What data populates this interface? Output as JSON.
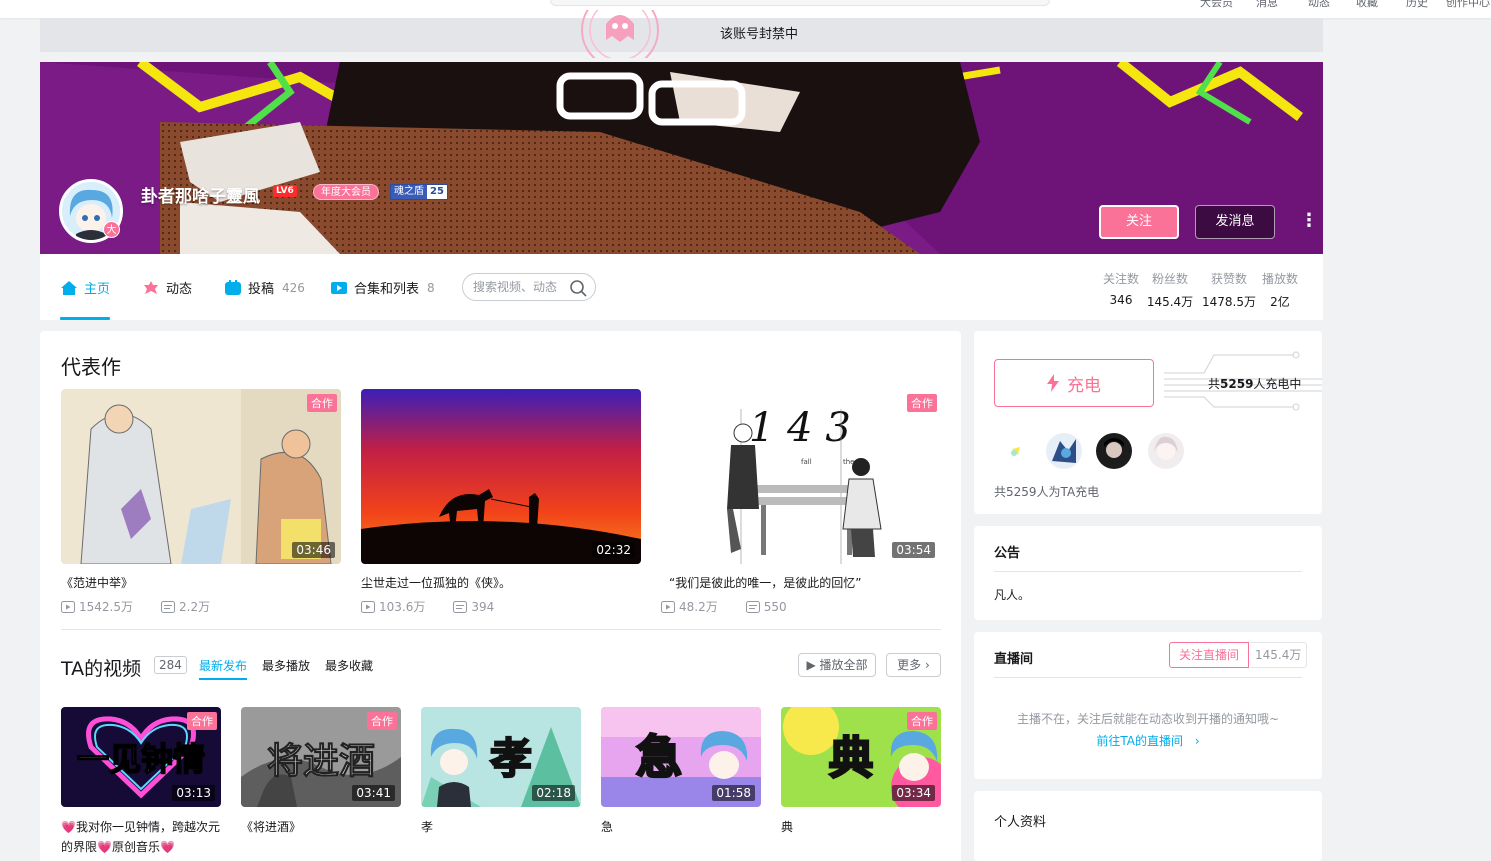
{
  "header": {
    "nav_fragments": [
      "大会员",
      "消息",
      "动态",
      "收藏",
      "历史",
      "创作中心"
    ]
  },
  "banned_notice": "该账号封禁中",
  "profile": {
    "username": "卦者那啥子靈風",
    "level": "LV6",
    "vip_label": "年度大会员",
    "medal_name": "魂之盾",
    "medal_level": "25",
    "avatar_badge": "大",
    "follow_label": "关注",
    "message_label": "发消息"
  },
  "tabs": [
    {
      "label": "主页",
      "count": ""
    },
    {
      "label": "动态",
      "count": ""
    },
    {
      "label": "投稿",
      "count": "426"
    },
    {
      "label": "合集和列表",
      "count": "8"
    }
  ],
  "search": {
    "placeholder": "搜索视频、动态"
  },
  "stats": [
    {
      "label": "关注数",
      "value": "346"
    },
    {
      "label": "粉丝数",
      "value": "145.4万"
    },
    {
      "label": "获赞数",
      "value": "1478.5万"
    },
    {
      "label": "播放数",
      "value": "2亿"
    }
  ],
  "representative": {
    "title": "代表作",
    "videos": [
      {
        "title": "《范进中举》",
        "duration": "03:46",
        "plays": "1542.5万",
        "danmaku": "2.2万",
        "coop": "合作"
      },
      {
        "title": "尘世走过一位孤独的《侠》。",
        "duration": "02:32",
        "plays": "103.6万",
        "danmaku": "394",
        "coop": ""
      },
      {
        "title": "“我们是彼此的唯一，是彼此的回忆”",
        "duration": "03:54",
        "plays": "48.2万",
        "danmaku": "550",
        "coop": "合作"
      }
    ]
  },
  "ta_videos": {
    "title": "TA的视频",
    "count": "284",
    "sorts": [
      "最新发布",
      "最多播放",
      "最多收藏"
    ],
    "play_all": "播放全部",
    "more": "更多",
    "videos": [
      {
        "title": "💗我对你一见钟情，跨越次元的界限💗原创音乐💗",
        "duration": "03:13",
        "coop": "合作",
        "cover_text": "一见钟情"
      },
      {
        "title": "《将进酒》",
        "duration": "03:41",
        "coop": "合作",
        "cover_text": "将进酒"
      },
      {
        "title": "孝",
        "duration": "02:18",
        "coop": "",
        "cover_text": "孝"
      },
      {
        "title": "急",
        "duration": "01:58",
        "coop": "",
        "cover_text": "急"
      },
      {
        "title": "典",
        "duration": "03:34",
        "coop": "合作",
        "cover_text": "典"
      }
    ]
  },
  "charge": {
    "button_label": "充电",
    "count_prefix": "共",
    "count_value": "5259",
    "count_suffix": "人充电中",
    "total_text": "共5259人为TA充电"
  },
  "notice": {
    "title": "公告",
    "text": "凡人。"
  },
  "live": {
    "title": "直播间",
    "follow_label": "关注直播间",
    "follow_count": "145.4万",
    "status_text": "主播不在，关注后就能在动态收到开播的通知哦~",
    "link_text": "前往TA的直播间"
  },
  "personal_info": {
    "title": "个人资料"
  },
  "colors": {
    "accent_blue": "#00aeec",
    "pink": "#fb7299",
    "bg": "#f1f2f3"
  }
}
